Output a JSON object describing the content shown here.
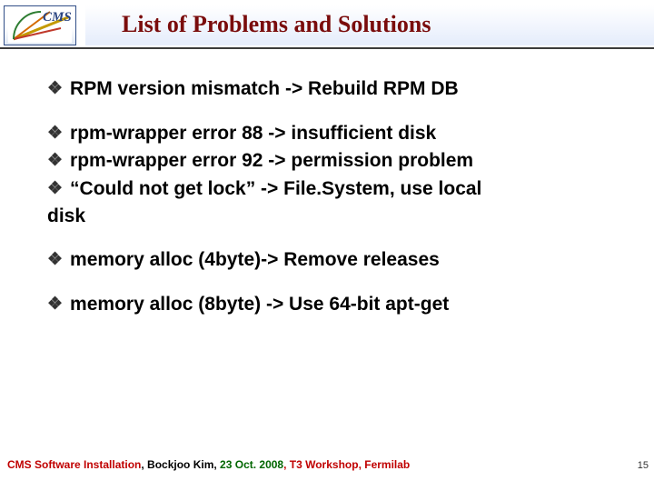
{
  "header": {
    "title": "List of Problems and Solutions",
    "logo_label": "CMS"
  },
  "bullets": {
    "b1": "RPM version mismatch -> Rebuild RPM DB",
    "b2": "rpm-wrapper error 88 -> insufficient disk",
    "b3": "rpm-wrapper error 92 -> permission problem",
    "b4": "“Could not get lock” -> File.System, use local",
    "b4_cont": "disk",
    "b5": "memory alloc (4byte)-> Remove releases",
    "b6": "memory alloc (8byte) -> Use 64-bit apt-get"
  },
  "footer": {
    "part1": "CMS Software Installation",
    "comma1": ", ",
    "author": "Bockjoo Kim, ",
    "date": "23 Oct. 2008",
    "comma2": ", ",
    "part2": "T3 Workshop, Fermilab"
  },
  "slidenum": "15"
}
